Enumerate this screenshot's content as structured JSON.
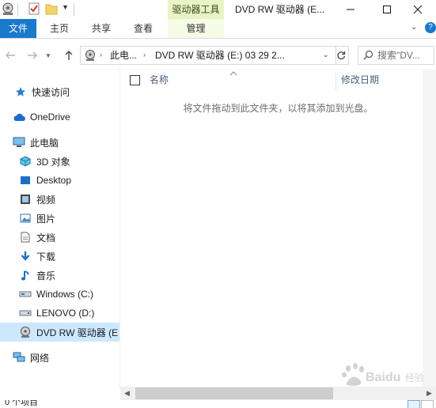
{
  "titlebar": {
    "tool_tab": "驱动器工具",
    "window_title": "DVD RW 驱动器 (E...",
    "buttons": [
      "minimize",
      "maximize",
      "close"
    ]
  },
  "ribbon": {
    "tabs": [
      "文件",
      "主页",
      "共享",
      "查看",
      "管理"
    ]
  },
  "address": {
    "path_part1": "此电...",
    "path_part2": "DVD RW 驱动器 (E:) 03 29 2...",
    "search_placeholder": "搜索\"DV..."
  },
  "navpane": {
    "items": [
      {
        "label": "快速访问",
        "icon": "star-icon"
      },
      {
        "label": "OneDrive",
        "icon": "cloud-icon"
      },
      {
        "label": "此电脑",
        "icon": "computer-icon"
      },
      {
        "label": "3D 对象",
        "icon": "cube-icon"
      },
      {
        "label": "Desktop",
        "icon": "desktop-icon"
      },
      {
        "label": "视频",
        "icon": "video-icon"
      },
      {
        "label": "图片",
        "icon": "picture-icon"
      },
      {
        "label": "文档",
        "icon": "document-icon"
      },
      {
        "label": "下载",
        "icon": "download-icon"
      },
      {
        "label": "音乐",
        "icon": "music-icon"
      },
      {
        "label": "Windows (C:)",
        "icon": "drive-icon"
      },
      {
        "label": "LENOVO (D:)",
        "icon": "drive-icon"
      },
      {
        "label": "DVD RW 驱动器 (E",
        "icon": "dvd-icon"
      },
      {
        "label": "网络",
        "icon": "network-icon"
      }
    ]
  },
  "content": {
    "col_name": "名称",
    "col_date": "修改日期",
    "empty_message": "将文件拖动到此文件夹，以将其添加到光盘。"
  },
  "status": {
    "text": "0 个项目"
  },
  "watermark": {
    "text": "Baidu经验"
  },
  "colors": {
    "accent": "#1979ca",
    "tool_tab": "#e9f3c7",
    "selection": "#cce8ff"
  }
}
